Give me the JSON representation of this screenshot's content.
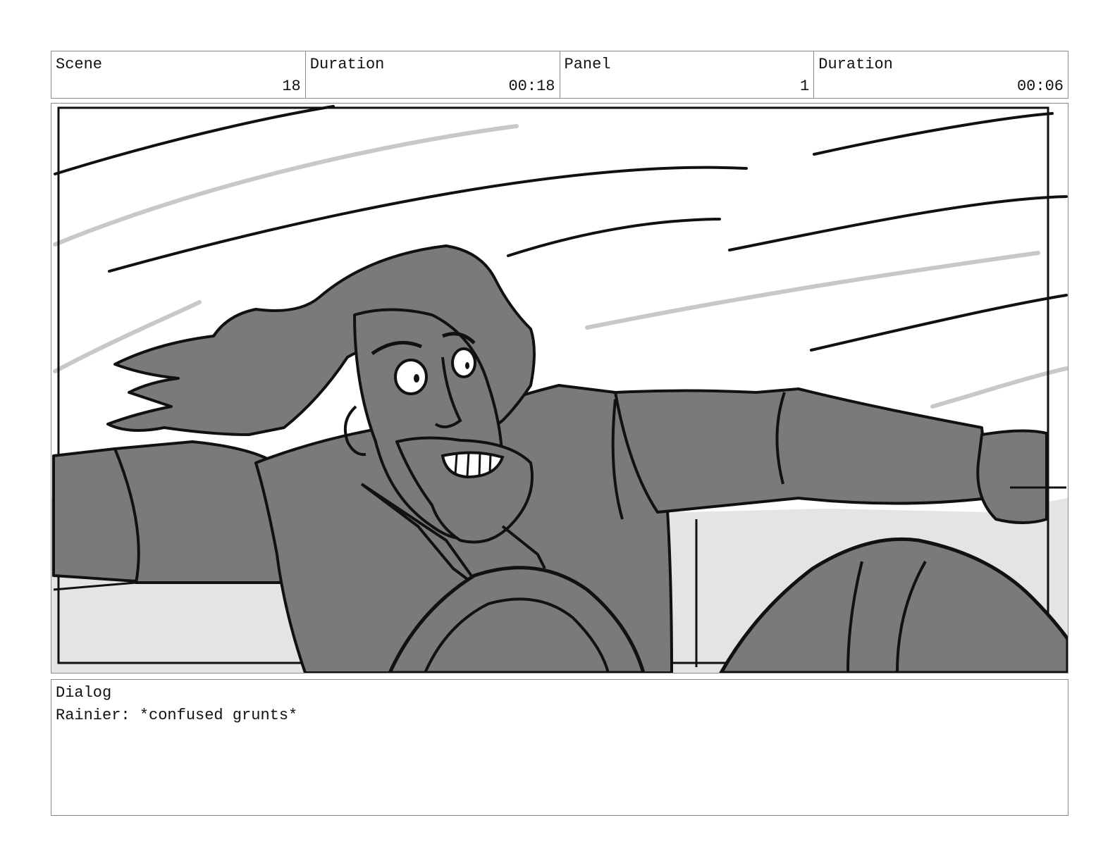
{
  "header": {
    "scene_label": "Scene",
    "scene_value": "18",
    "scene_duration_label": "Duration",
    "scene_duration_value": "00:18",
    "panel_label": "Panel",
    "panel_value": "1",
    "panel_duration_label": "Duration",
    "panel_duration_value": "00:06"
  },
  "dialog": {
    "label": "Dialog",
    "text": "Rainier: *confused grunts*"
  },
  "colors": {
    "border": "#8a8a8a",
    "ink": "#111111",
    "figure_fill": "#7a7a7a",
    "background_fill": "#e4e4e4",
    "speed_line_gray": "#c8c8c8"
  }
}
